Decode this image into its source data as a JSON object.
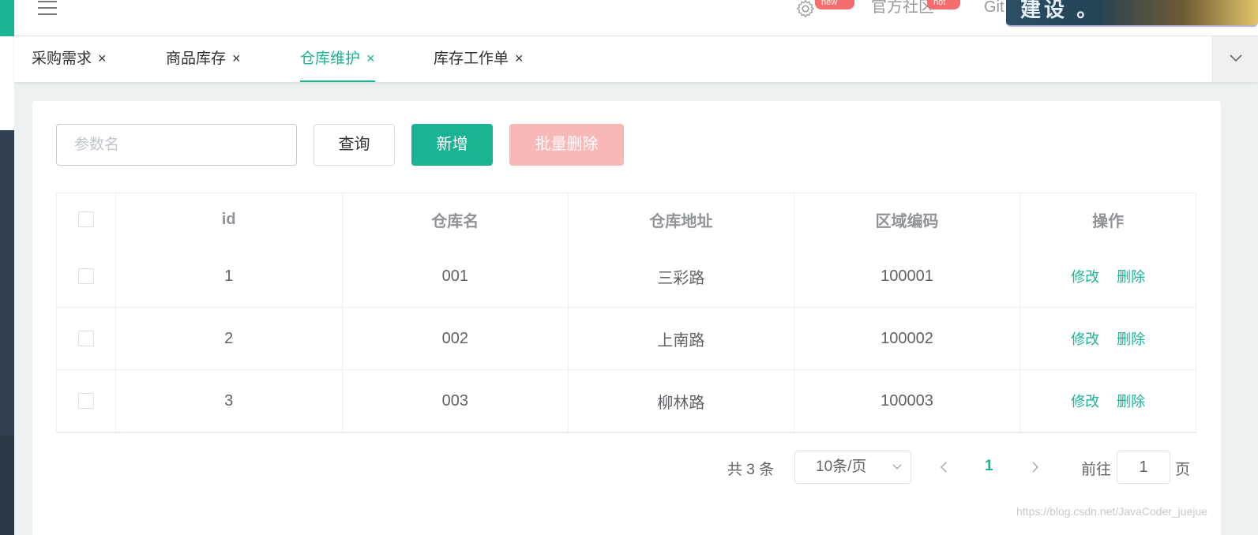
{
  "header": {
    "community_label": "官方社区",
    "git_label": "Git",
    "badge_new": "new",
    "badge_hot": "hot",
    "banner_text": "建设 。"
  },
  "tabs": [
    {
      "label": "采购需求",
      "close": "×"
    },
    {
      "label": "商品库存",
      "close": "×"
    },
    {
      "label": "仓库维护",
      "close": "×",
      "active": true
    },
    {
      "label": "库存工作单",
      "close": "×"
    }
  ],
  "toolbar": {
    "search_placeholder": "参数名",
    "query_label": "查询",
    "add_label": "新增",
    "batch_delete_label": "批量删除"
  },
  "table": {
    "columns": [
      "id",
      "仓库名",
      "仓库地址",
      "区域编码",
      "操作"
    ],
    "rows": [
      {
        "id": "1",
        "name": "001",
        "address": "三彩路",
        "region_code": "100001"
      },
      {
        "id": "2",
        "name": "002",
        "address": "上南路",
        "region_code": "100002"
      },
      {
        "id": "3",
        "name": "003",
        "address": "柳林路",
        "region_code": "100003"
      }
    ],
    "edit_label": "修改",
    "delete_label": "删除"
  },
  "pagination": {
    "total_text": "共 3 条",
    "page_size": "10条/页",
    "current_page": "1",
    "goto_label": "前往",
    "goto_value": "1",
    "page_suffix": "页"
  },
  "watermark": "https://blog.csdn.net/JavaCoder_juejue",
  "colors": {
    "primary": "#1ab394",
    "danger_light": "#f8b8b8",
    "badge": "#f56c6c",
    "sidebar": "#2f4050"
  }
}
